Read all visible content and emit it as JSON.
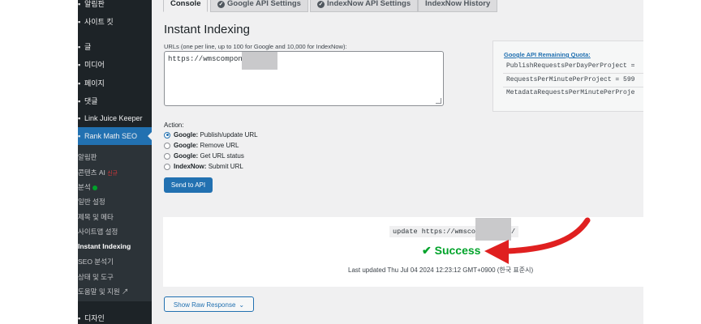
{
  "sidebar": {
    "items": [
      {
        "label": "알림판",
        "icon": "dashboard-icon"
      },
      {
        "label": "사이트 킷",
        "icon": "sitekit-icon"
      },
      {
        "label": "글",
        "icon": "pin-icon"
      },
      {
        "label": "미디어",
        "icon": "media-icon"
      },
      {
        "label": "페이지",
        "icon": "page-icon"
      },
      {
        "label": "댓글",
        "icon": "comment-icon"
      },
      {
        "label": "Link Juice Keeper",
        "icon": "link-icon"
      },
      {
        "label": "Rank Math SEO",
        "icon": "rankmath-icon"
      }
    ],
    "submenu": [
      {
        "label": "알림판"
      },
      {
        "label": "콘텐츠 AI",
        "badge": "신규"
      },
      {
        "label": "분석"
      },
      {
        "label": "일반 설정"
      },
      {
        "label": "제목 및 메타"
      },
      {
        "label": "사이트맵 설정"
      },
      {
        "label": "Instant Indexing"
      },
      {
        "label": "SEO 분석기"
      },
      {
        "label": "상태 및 도구"
      },
      {
        "label": "도움말 및 지원"
      }
    ],
    "bottom_item": {
      "label": "디자인",
      "icon": "design-icon"
    }
  },
  "tabs": [
    {
      "label": "Console",
      "active": true,
      "icon": ""
    },
    {
      "label": "Google API Settings",
      "active": false,
      "icon": "check-circle-icon"
    },
    {
      "label": "IndexNow API Settings",
      "active": false,
      "icon": "check-circle-icon"
    },
    {
      "label": "IndexNow History",
      "active": false,
      "icon": ""
    }
  ],
  "main": {
    "title": "Instant Indexing",
    "urls_hint": "URLs (one per line, up to 100 for Google and 10,000 for IndexNow):",
    "urls_value": "https://wmscompon",
    "action_label": "Action:",
    "actions": [
      {
        "strong": "Google:",
        "text": "Publish/update URL",
        "checked": true
      },
      {
        "strong": "Google:",
        "text": "Remove URL",
        "checked": false
      },
      {
        "strong": "Google:",
        "text": "Get URL status",
        "checked": false
      },
      {
        "strong": "IndexNow:",
        "text": "Submit URL",
        "checked": false
      }
    ],
    "send_button": "Send to API"
  },
  "quota": {
    "title": "Google API Remaining Quota:",
    "rows": [
      "PublishRequestsPerDayPerProject =",
      "RequestsPerMinutePerProject = 599",
      "MetadataRequestsPerMinutePerProje"
    ]
  },
  "result": {
    "command": "update https://wmsco",
    "command_tail": "/",
    "status": "Success",
    "status_icon": "checkmark-icon",
    "last_updated": "Last updated Thu Jul 04 2024 12:23:12 GMT+0900 (한국 표준시)"
  },
  "raw_button": "Show Raw Response",
  "colors": {
    "sidebar_bg": "#1d2327",
    "accent": "#2271b1",
    "success": "#00a32a",
    "arrow": "#e02020"
  }
}
